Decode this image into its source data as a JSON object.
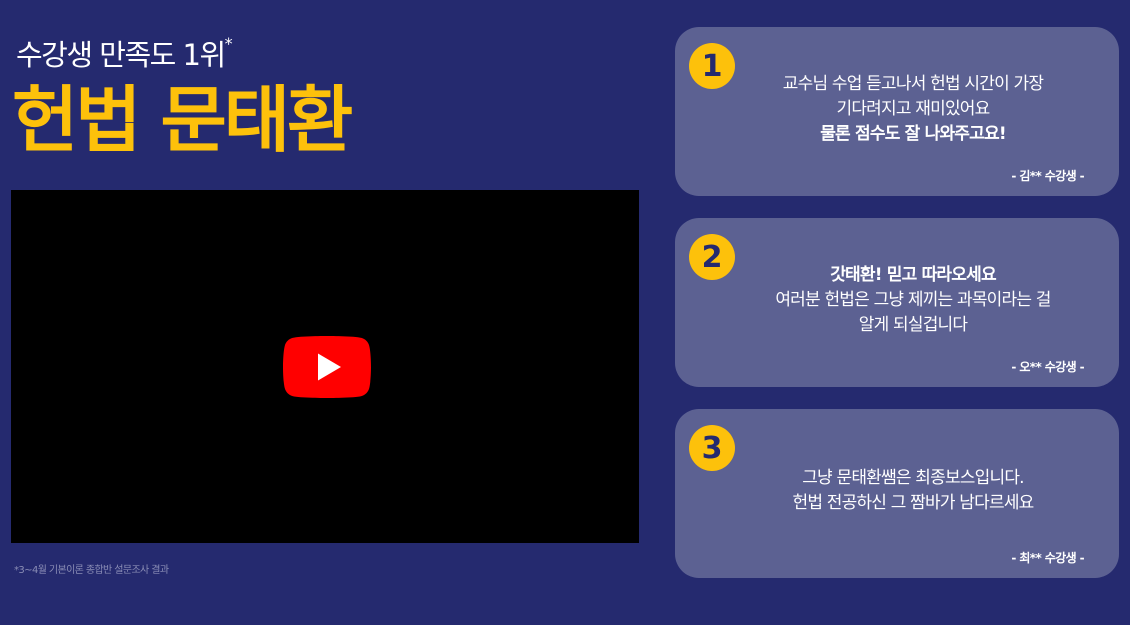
{
  "header": {
    "subtitle": "수강생 만족도 1위",
    "subtitle_mark": "*",
    "title": "헌법 문태환"
  },
  "video": {
    "play_icon": "youtube-play-icon",
    "brand_color": "#ff0000"
  },
  "footnote": "*3~4월 기본이론 종합반 설문조사 결과",
  "reviews": [
    {
      "number": "1",
      "lines": [
        "교수님 수업 듣고나서 헌법 시간이 가장",
        "기다려지고 재미있어요",
        "물론 점수도 잘 나와주고요!"
      ],
      "author": "- 김** 수강생 -"
    },
    {
      "number": "2",
      "lines": [
        "갓태환! 믿고 따라오세요",
        "여러분 헌법은 그냥 제끼는 과목이라는 걸",
        "알게 되실겁니다"
      ],
      "author": "- 오** 수강생 -"
    },
    {
      "number": "3",
      "lines": [
        "그냥 문태환쌤은 최종보스입니다.",
        "헌법 전공하신 그 짬바가 남다르세요"
      ],
      "author": "- 최** 수강생 -"
    }
  ],
  "colors": {
    "background": "#252a6f",
    "accent": "#fdc10b",
    "card": "#5c6192"
  }
}
